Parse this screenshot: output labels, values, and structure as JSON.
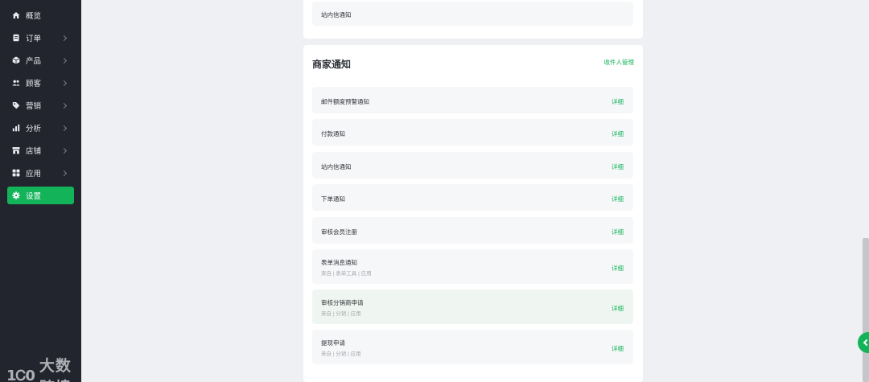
{
  "sidebar": {
    "items": [
      {
        "label": "概览",
        "icon": "home-icon",
        "chevron": false,
        "active": false
      },
      {
        "label": "订单",
        "icon": "order-icon",
        "chevron": true,
        "active": false
      },
      {
        "label": "产品",
        "icon": "product-icon",
        "chevron": true,
        "active": false
      },
      {
        "label": "顾客",
        "icon": "customers-icon",
        "chevron": true,
        "active": false
      },
      {
        "label": "营销",
        "icon": "tag-icon",
        "chevron": true,
        "active": false
      },
      {
        "label": "分析",
        "icon": "bar-chart-icon",
        "chevron": true,
        "active": false
      },
      {
        "label": "店铺",
        "icon": "store-icon",
        "chevron": true,
        "active": false
      },
      {
        "label": "应用",
        "icon": "apps-icon",
        "chevron": true,
        "active": false
      },
      {
        "label": "设置",
        "icon": "gear-icon",
        "chevron": false,
        "active": true
      }
    ]
  },
  "watermark": {
    "logo": "1Ꮯ0",
    "text": "大数跨境"
  },
  "top_card": {
    "row_title": "站内信通知"
  },
  "merchant": {
    "title": "商家通知",
    "recipient_link": "收件人管理",
    "rows": [
      {
        "title": "邮件额度预警通知",
        "sub": "",
        "detail": "详细"
      },
      {
        "title": "付款通知",
        "sub": "",
        "detail": "详细"
      },
      {
        "title": "站内信通知",
        "sub": "",
        "detail": "详细"
      },
      {
        "title": "下单通知",
        "sub": "",
        "detail": "详细"
      },
      {
        "title": "审核会员注册",
        "sub": "",
        "detail": "详细"
      },
      {
        "title": "表单消息通知",
        "sub": "来自 | 表单工具 | 应用",
        "detail": "详细"
      },
      {
        "title": "审核分销商申请",
        "sub": "来自 | 分销 | 应用",
        "detail": "详细"
      },
      {
        "title": "提现申请",
        "sub": "来自 | 分销 | 应用",
        "detail": "详细"
      }
    ]
  },
  "colors": {
    "accent": "#13b35a",
    "sidebar_bg": "#22252d",
    "page_bg": "#eef0f3"
  }
}
